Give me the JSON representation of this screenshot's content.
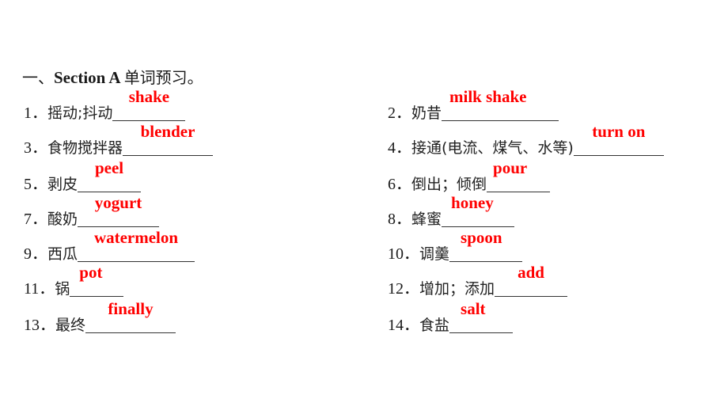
{
  "heading": {
    "prefix": "一、",
    "section": "Section A ",
    "title": "单词预习。"
  },
  "colors": {
    "answer": "#ff0000",
    "text": "#1a1a1a"
  },
  "items": [
    {
      "num": "1．",
      "prompt": "摇动;抖动",
      "answer": "shake"
    },
    {
      "num": "2．",
      "prompt": "奶昔",
      "answer": "milk shake"
    },
    {
      "num": "3．",
      "prompt": "食物搅拌器",
      "answer": "blender"
    },
    {
      "num": "4．",
      "prompt": "接通(电流、煤气、水等)",
      "answer": "turn on"
    },
    {
      "num": "5．",
      "prompt": "剥皮",
      "answer": "peel"
    },
    {
      "num": "6．",
      "prompt": "倒出；倾倒",
      "answer": "pour"
    },
    {
      "num": "7．",
      "prompt": "酸奶",
      "answer": "yogurt"
    },
    {
      "num": "8．",
      "prompt": "蜂蜜",
      "answer": "honey"
    },
    {
      "num": "9．",
      "prompt": "西瓜",
      "answer": "watermelon"
    },
    {
      "num": "10．",
      "prompt": "调羹",
      "answer": "spoon"
    },
    {
      "num": "11．",
      "prompt": "锅",
      "answer": "pot"
    },
    {
      "num": "12．",
      "prompt": "增加；添加",
      "answer": "add"
    },
    {
      "num": "13．",
      "prompt": "最终",
      "answer": "finally"
    },
    {
      "num": "14．",
      "prompt": "食盐",
      "answer": "salt"
    }
  ]
}
